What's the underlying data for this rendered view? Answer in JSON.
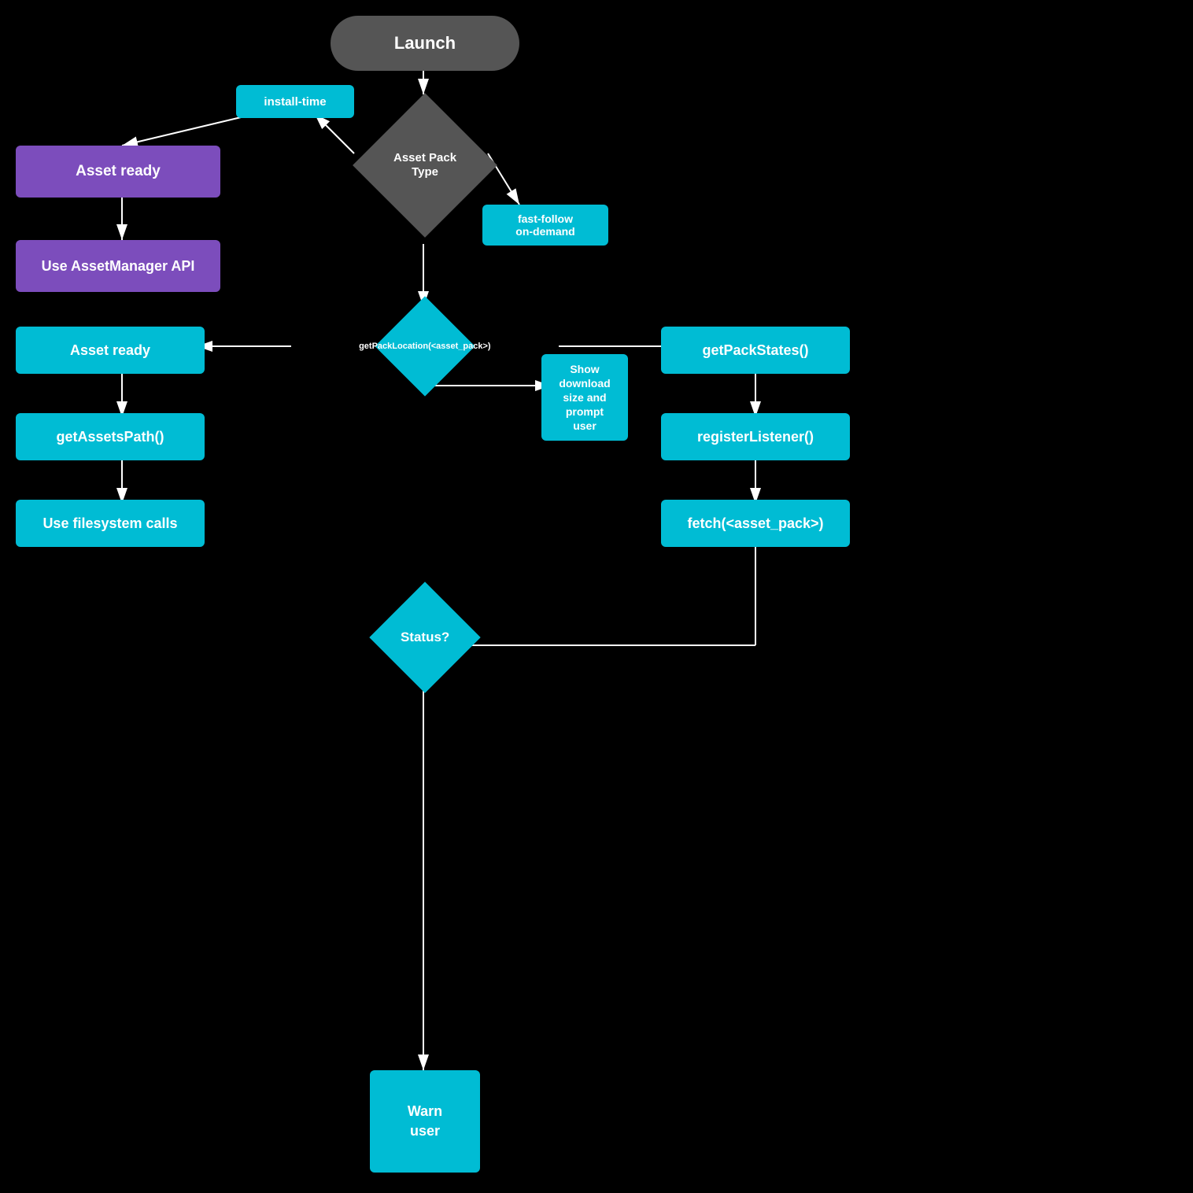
{
  "nodes": {
    "launch": {
      "label": "Launch"
    },
    "asset_pack_type": {
      "label": "Asset Pack\nType"
    },
    "install_time_label": {
      "label": "install-time"
    },
    "fast_follow_label": {
      "label": "fast-follow\non-demand"
    },
    "asset_ready_1": {
      "label": "Asset ready"
    },
    "use_asset_manager": {
      "label": "Use AssetManager API"
    },
    "get_pack_location": {
      "label": "getPackLocation(<asset_pack>)"
    },
    "asset_ready_2": {
      "label": "Asset ready"
    },
    "get_assets_path": {
      "label": "getAssetsPath()"
    },
    "use_filesystem": {
      "label": "Use filesystem calls"
    },
    "show_download": {
      "label": "Show\ndownload\nsize and\nprompt\nuser"
    },
    "get_pack_states": {
      "label": "getPackStates()"
    },
    "register_listener": {
      "label": "registerListener()"
    },
    "fetch": {
      "label": "fetch(<asset_pack>)"
    },
    "status": {
      "label": "Status?"
    },
    "warn_user": {
      "label": "Warn\nuser"
    }
  }
}
